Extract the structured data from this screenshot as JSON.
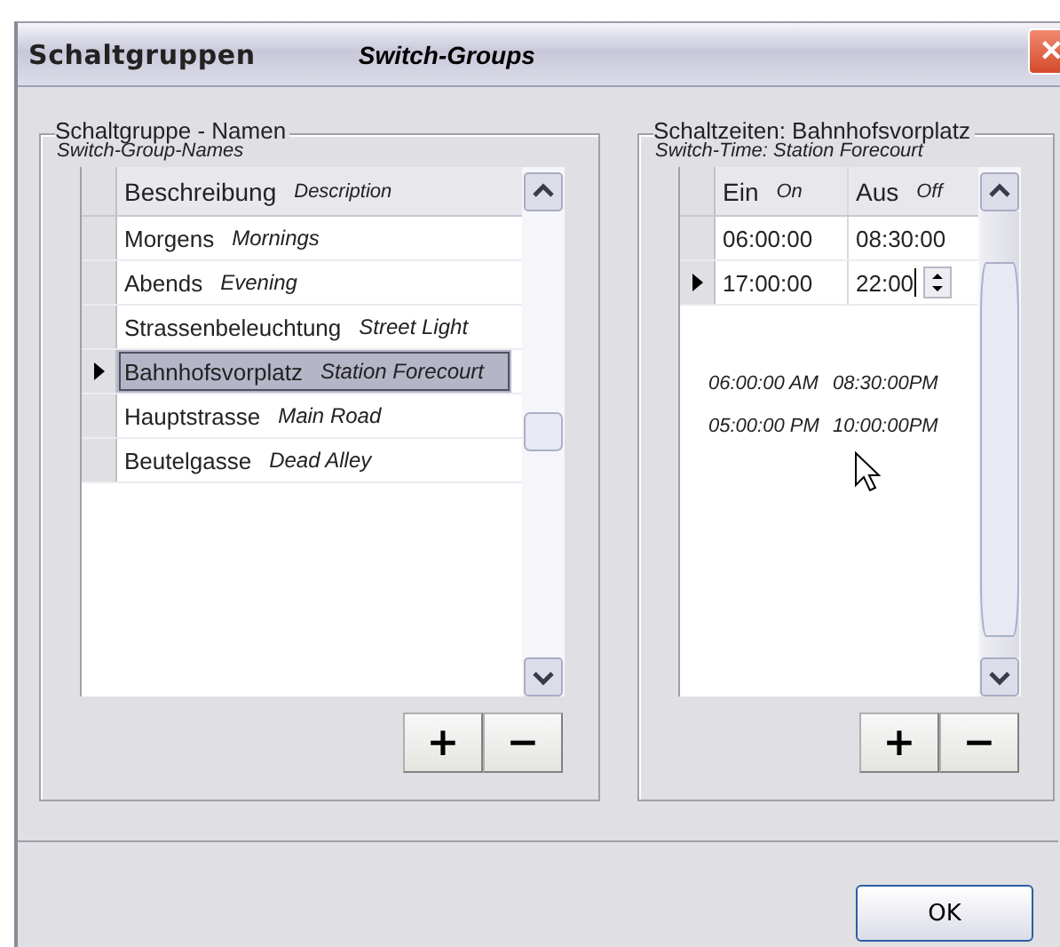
{
  "window": {
    "title": "Schaltgruppen",
    "title_translation": "Switch-Groups",
    "close": "✕"
  },
  "groups": [
    {
      "title": "Schaltgruppe - Namen",
      "subtitle": "Switch-Group-Names",
      "columns": [
        {
          "label": "Beschreibung",
          "translation": "Description"
        }
      ],
      "rows": [
        {
          "cells": [
            {
              "text": "Morgens",
              "translation": "Mornings"
            }
          ],
          "selected": false,
          "editing": false
        },
        {
          "cells": [
            {
              "text": "Abends",
              "translation": "Evening"
            }
          ],
          "selected": false,
          "editing": false
        },
        {
          "cells": [
            {
              "text": "Strassenbeleuchtung",
              "translation": "Street Light"
            }
          ],
          "selected": false,
          "editing": false
        },
        {
          "cells": [
            {
              "text": "Bahnhofsvorplatz",
              "translation": "Station Forecourt"
            }
          ],
          "selected": true,
          "editing": false
        },
        {
          "cells": [
            {
              "text": "Hauptstrasse",
              "translation": "Main Road"
            }
          ],
          "selected": false,
          "editing": false
        },
        {
          "cells": [
            {
              "text": "Beutelgasse",
              "translation": "Dead Alley"
            }
          ],
          "selected": false,
          "editing": false
        }
      ],
      "buttons": [
        "+",
        "−"
      ]
    },
    {
      "title": "Schaltzeiten: Bahnhofsvorplatz",
      "subtitle": "Switch-Time: Station Forecourt",
      "columns": [
        {
          "label": "Ein",
          "translation": "On"
        },
        {
          "label": "Aus",
          "translation": "Off"
        }
      ],
      "rows": [
        {
          "cells": [
            {
              "text": "06:00:00"
            },
            {
              "text": "08:30:00"
            }
          ],
          "selected": false,
          "editing": false
        },
        {
          "cells": [
            {
              "text": "17:00:00"
            },
            {
              "text": "22:00"
            }
          ],
          "selected": true,
          "editing": true
        }
      ],
      "notes": [
        [
          "06:00:00 AM",
          "08:30:00PM"
        ],
        [
          "05:00:00 PM",
          "10:00:00PM"
        ]
      ],
      "buttons": [
        "+",
        "−"
      ]
    }
  ],
  "ok_button": "OK"
}
